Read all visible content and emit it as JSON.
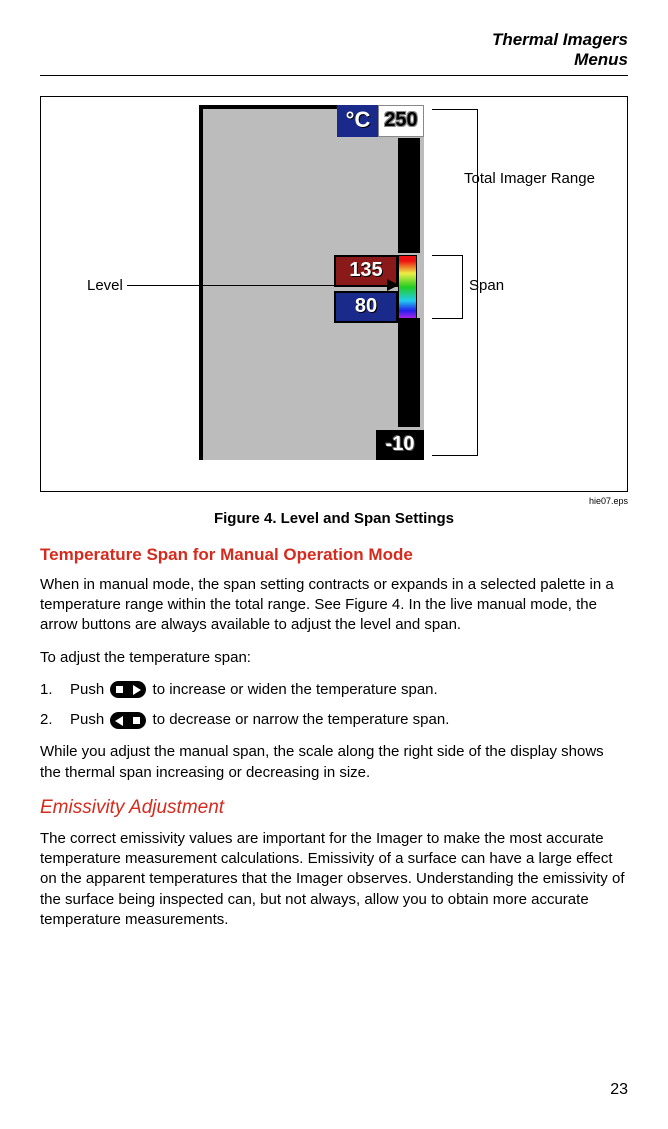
{
  "header": {
    "line1": "Thermal Imagers",
    "line2": "Menus"
  },
  "figure": {
    "unit": "°C",
    "max_temp": "250",
    "high_value": "135",
    "low_value": "80",
    "min_temp": "-10",
    "callout_level": "Level",
    "callout_span": "Span",
    "callout_total": "Total Imager Range",
    "eps": "hie07.eps",
    "caption": "Figure 4. Level and Span Settings"
  },
  "sections": {
    "span_heading": "Temperature Span for Manual Operation Mode",
    "span_para1": "When in manual mode, the span setting contracts or expands in a selected palette in a temperature range within the total range. See Figure 4. In the live manual mode, the arrow buttons are always available to adjust the level and span.",
    "span_para2": "To adjust the temperature span:",
    "step1_pre": "Push ",
    "step1_post": " to increase or widen the temperature span.",
    "step2_pre": "Push ",
    "step2_post": " to decrease or narrow the temperature span.",
    "span_para3": "While you adjust the manual span, the scale along the right side of the display shows the thermal span increasing or decreasing in size.",
    "emissivity_heading": "Emissivity Adjustment",
    "emissivity_para": "The correct emissivity values are important for the Imager to make the most accurate temperature measurement calculations. Emissivity of a surface can have a large effect on the apparent temperatures that the Imager observes. Understanding the emissivity of the surface being inspected can, but not always, allow you to obtain more accurate temperature measurements."
  },
  "page_number": "23"
}
